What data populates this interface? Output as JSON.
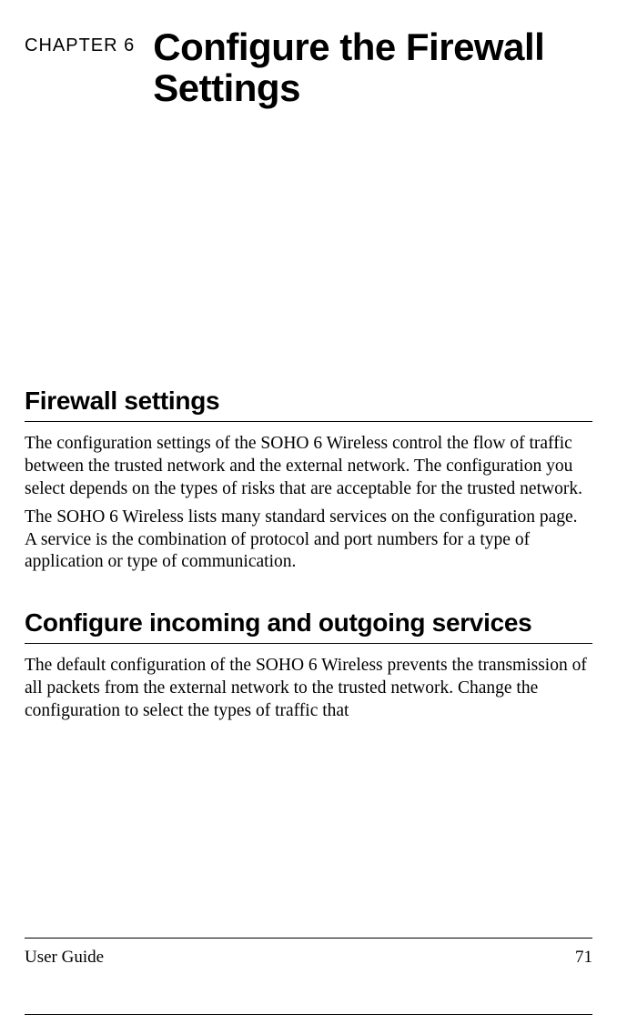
{
  "chapter_label": "CHAPTER 6",
  "chapter_title": "Configure the Firewall Settings",
  "sections": [
    {
      "heading": "Firewall settings",
      "paragraphs": [
        "The configuration settings of the SOHO 6 Wireless control the flow of traffic between the trusted network and the external network. The configuration you select depends on the types of risks that are acceptable for the trusted network.",
        "The SOHO 6 Wireless lists many standard services on the configuration page. A service is the combination of protocol and port numbers for a type of application or type of communication."
      ]
    },
    {
      "heading": "Configure incoming and outgoing services",
      "paragraphs": [
        "The default configuration of the SOHO 6 Wireless prevents the transmission of all packets from the external network to the trusted network. Change the configuration to select the types of traffic that"
      ]
    }
  ],
  "footer": {
    "left": "User Guide",
    "right": "71"
  }
}
